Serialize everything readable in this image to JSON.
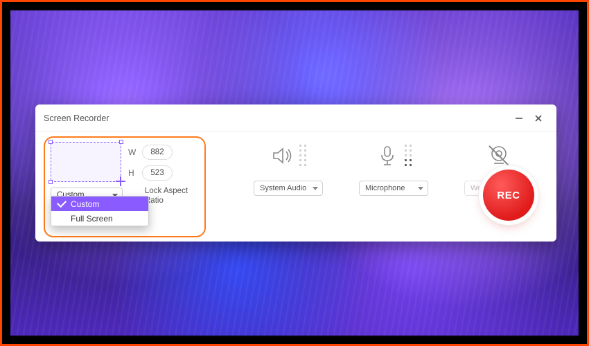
{
  "window": {
    "title": "Screen Recorder"
  },
  "region": {
    "width_label": "W",
    "height_label": "H",
    "width_value": "882",
    "height_value": "523",
    "mode_selected": "Custom",
    "lock_aspect_label": "Lock Aspect Ratio",
    "dropdown_options": [
      "Custom",
      "Full Screen"
    ]
  },
  "controls": {
    "system_audio": {
      "label": "System Audio",
      "icon": "speaker-icon",
      "enabled": true
    },
    "microphone": {
      "label": "Microphone",
      "icon": "microphone-icon",
      "enabled": true
    },
    "webcam": {
      "label": "Webcam",
      "icon": "webcam-icon",
      "enabled": false
    }
  },
  "record_button": {
    "label": "REC"
  },
  "colors": {
    "accent_purple": "#8a5cff",
    "accent_orange": "#ff7a1a",
    "rec_red": "#e01b1b"
  }
}
